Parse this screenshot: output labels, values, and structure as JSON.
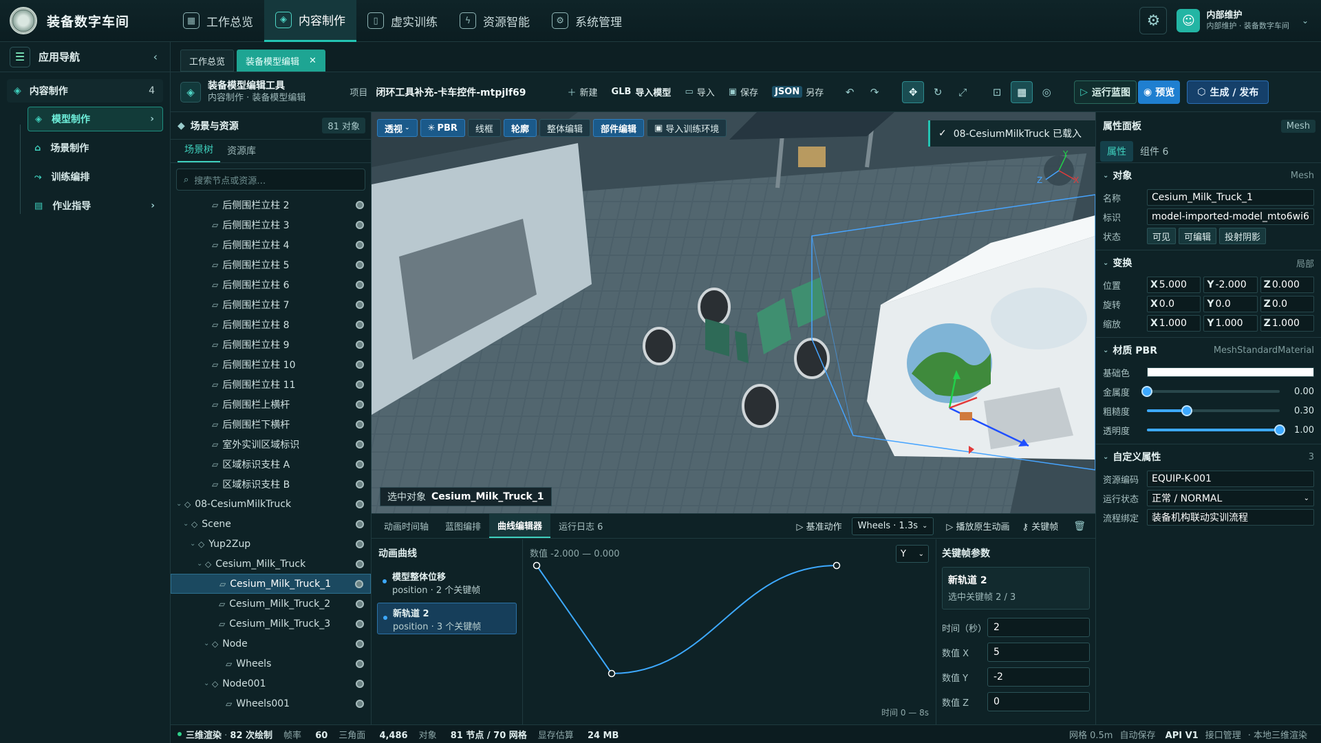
{
  "app": {
    "name": "装备数字车间"
  },
  "topnav": [
    {
      "label": "工作总览",
      "icon": "grid-icon"
    },
    {
      "label": "内容制作",
      "icon": "cube-icon"
    },
    {
      "label": "虚实训练",
      "icon": "book-icon"
    },
    {
      "label": "资源智能",
      "icon": "plug-icon"
    },
    {
      "label": "系统管理",
      "icon": "gear-icon"
    }
  ],
  "user": {
    "name": "内部维护",
    "sub": "内部维护 · 装备数字车间"
  },
  "leftnav": {
    "title": "应用导航",
    "group": {
      "label": "内容制作",
      "count": "4"
    },
    "items": [
      {
        "label": "模型制作"
      },
      {
        "label": "场景制作"
      },
      {
        "label": "训练编排"
      },
      {
        "label": "作业指导"
      }
    ]
  },
  "tabs": [
    {
      "label": "工作总览"
    },
    {
      "label": "装备模型编辑"
    }
  ],
  "toolbar": {
    "title": "装备模型编辑工具",
    "subtitle": "内容制作 · 装备模型编辑",
    "project_label": "项目",
    "project_name": "闭环工具补充-卡车控件-mtpjlf69",
    "new": "新建",
    "glb_prefix": "GLB",
    "import_model": "导入模型",
    "import": "导入",
    "save": "保存",
    "json": "JSON",
    "saveas": "另存",
    "run": "运行蓝图",
    "preview": "预览",
    "publish": "生成 / 发布"
  },
  "scene": {
    "title": "场景与资源",
    "count": "81 对象",
    "tabs": [
      "场景树",
      "资源库"
    ],
    "search_placeholder": "搜索节点或资源…",
    "nodes": [
      {
        "label": "后侧围栏立柱 2",
        "depth": 3,
        "kind": "mesh"
      },
      {
        "label": "后侧围栏立柱 3",
        "depth": 3,
        "kind": "mesh"
      },
      {
        "label": "后侧围栏立柱 4",
        "depth": 3,
        "kind": "mesh"
      },
      {
        "label": "后侧围栏立柱 5",
        "depth": 3,
        "kind": "mesh"
      },
      {
        "label": "后侧围栏立柱 6",
        "depth": 3,
        "kind": "mesh"
      },
      {
        "label": "后侧围栏立柱 7",
        "depth": 3,
        "kind": "mesh"
      },
      {
        "label": "后侧围栏立柱 8",
        "depth": 3,
        "kind": "mesh"
      },
      {
        "label": "后侧围栏立柱 9",
        "depth": 3,
        "kind": "mesh"
      },
      {
        "label": "后侧围栏立柱 10",
        "depth": 3,
        "kind": "mesh"
      },
      {
        "label": "后侧围栏立柱 11",
        "depth": 3,
        "kind": "mesh"
      },
      {
        "label": "后侧围栏上横杆",
        "depth": 3,
        "kind": "mesh"
      },
      {
        "label": "后侧围栏下横杆",
        "depth": 3,
        "kind": "mesh"
      },
      {
        "label": "室外实训区域标识",
        "depth": 3,
        "kind": "mesh"
      },
      {
        "label": "区域标识支柱 A",
        "depth": 3,
        "kind": "mesh"
      },
      {
        "label": "区域标识支柱 B",
        "depth": 3,
        "kind": "mesh"
      },
      {
        "label": "08-CesiumMilkTruck",
        "depth": 0,
        "kind": "group"
      },
      {
        "label": "Scene",
        "depth": 1,
        "kind": "group"
      },
      {
        "label": "Yup2Zup",
        "depth": 2,
        "kind": "group"
      },
      {
        "label": "Cesium_Milk_Truck",
        "depth": 3,
        "kind": "group"
      },
      {
        "label": "Cesium_Milk_Truck_1",
        "depth": 4,
        "kind": "mesh",
        "selected": true
      },
      {
        "label": "Cesium_Milk_Truck_2",
        "depth": 4,
        "kind": "mesh"
      },
      {
        "label": "Cesium_Milk_Truck_3",
        "depth": 4,
        "kind": "mesh"
      },
      {
        "label": "Node",
        "depth": 4,
        "kind": "group"
      },
      {
        "label": "Wheels",
        "depth": 5,
        "kind": "mesh"
      },
      {
        "label": "Node001",
        "depth": 4,
        "kind": "group"
      },
      {
        "label": "Wheels001",
        "depth": 5,
        "kind": "mesh"
      }
    ]
  },
  "viewport": {
    "modes": [
      "透视",
      "PBR",
      "线框",
      "轮廓",
      "整体编辑",
      "部件编辑",
      "导入训练环境"
    ],
    "toast": "08-CesiumMilkTruck 已载入",
    "selected_label": "选中对象",
    "selected_name": "Cesium_Milk_Truck_1",
    "gizmo": {
      "x": "X",
      "y": "Y",
      "z": "Z"
    }
  },
  "bottom": {
    "tabs": [
      "动画时间轴",
      "蓝图编排",
      "曲线编辑器",
      "运行日志 6"
    ],
    "base_action": "基准动作",
    "clip_select": "Wheels · 1.3s",
    "play_anim": "播放原生动画",
    "keyframe": "关键帧",
    "curves_title": "动画曲线",
    "curves": [
      {
        "name": "模型整体位移",
        "sub": "position · 2 个关键帧"
      },
      {
        "name": "新轨道 2",
        "sub": "position · 3 个关键帧"
      }
    ],
    "range": "数值 -2.000 — 0.000",
    "axis": "Y",
    "time": "时间 0 — 8s",
    "kf_title": "关键帧参数",
    "kf_card_title": "新轨道 2",
    "kf_card_sub": "选中关键帧 2 / 3",
    "kf_rows": [
      {
        "label": "时间（秒）",
        "value": "2"
      },
      {
        "label": "数值 X",
        "value": "5"
      },
      {
        "label": "数值 Y",
        "value": "-2"
      },
      {
        "label": "数值 Z",
        "value": "0"
      }
    ],
    "curve_points": [
      {
        "t": 0,
        "v": 0
      },
      {
        "t": 2,
        "v": -2
      },
      {
        "t": 8,
        "v": 0
      }
    ]
  },
  "props": {
    "title": "属性面板",
    "type": "Mesh",
    "tabs": [
      "属性",
      "组件 6"
    ],
    "object": {
      "title": "对象",
      "right": "Mesh",
      "name_label": "名称",
      "name": "Cesium_Milk_Truck_1",
      "id_label": "标识",
      "id": "model-imported-model_mto6wi6",
      "state_label": "状态",
      "states": [
        "可见",
        "可编辑",
        "投射阴影"
      ]
    },
    "transform": {
      "title": "变换",
      "right": "局部",
      "rows": [
        {
          "label": "位置",
          "x": "5.000",
          "y": "-2.000",
          "z": "0.000"
        },
        {
          "label": "旋转",
          "x": "0.0",
          "y": "0.0",
          "z": "0.0"
        },
        {
          "label": "缩放",
          "x": "1.000",
          "y": "1.000",
          "z": "1.000"
        }
      ]
    },
    "material": {
      "title": "材质 PBR",
      "right": "MeshStandardMaterial",
      "base_label": "基础色",
      "base_color": "#ffffff",
      "sliders": [
        {
          "label": "金属度",
          "value": 0.0,
          "text": "0.00"
        },
        {
          "label": "粗糙度",
          "value": 0.3,
          "text": "0.30"
        },
        {
          "label": "透明度",
          "value": 1.0,
          "text": "1.00"
        }
      ]
    },
    "custom": {
      "title": "自定义属性",
      "right": "3",
      "rows": [
        {
          "label": "资源编码",
          "value": "EQUIP-K-001",
          "type": "input"
        },
        {
          "label": "运行状态",
          "value": "正常 / NORMAL",
          "type": "select"
        },
        {
          "label": "流程绑定",
          "value": "装备机构联动实训流程",
          "type": "input"
        }
      ]
    }
  },
  "status": {
    "render": "三维渲染",
    "draws": "82 次绘制",
    "fps_label": "帧率",
    "fps": "60",
    "tri_label": "三角面",
    "tri": "4,486",
    "obj_label": "对象",
    "obj": "81 节点 / 70 网格",
    "mem_label": "显存估算",
    "mem": "24 MB",
    "grid": "网格 0.5m",
    "autosave_label": "自动保存",
    "autosave": "API V1",
    "api": "接口管理",
    "local": "本地三维渲染"
  }
}
